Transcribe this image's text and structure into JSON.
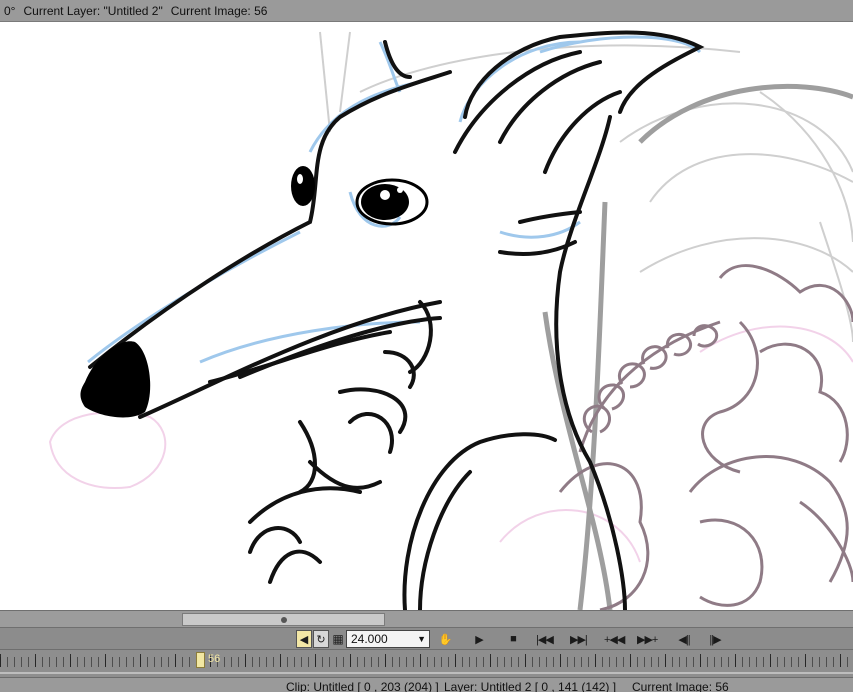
{
  "topbar": {
    "angle": "0°",
    "current_layer": "Current Layer: \"Untitled 2\"",
    "current_image": "Current Image: 56"
  },
  "playback": {
    "sound_icon": "speaker-icon",
    "loop_icon": "loop-icon",
    "onion_icon": "onion-skin-icon",
    "fps_value": "24.000",
    "hand_icon": "hand-icon",
    "play_icon": "play-icon",
    "stop_icon": "stop-icon",
    "first_icon": "first-frame-icon",
    "last_icon": "last-frame-icon",
    "add_before_icon": "insert-before-icon",
    "add_after_icon": "insert-after-icon",
    "prev_icon": "prev-frame-icon",
    "next_icon": "next-frame-icon"
  },
  "timeline": {
    "current_frame": "56",
    "scroll_position": 0.21
  },
  "status": {
    "clip": "Clip: Untitled [ 0 , 203  (204) ]",
    "layer": "Layer: Untitled 2 [ 0 , 141  (142) ]",
    "image": "Current Image: 56"
  }
}
